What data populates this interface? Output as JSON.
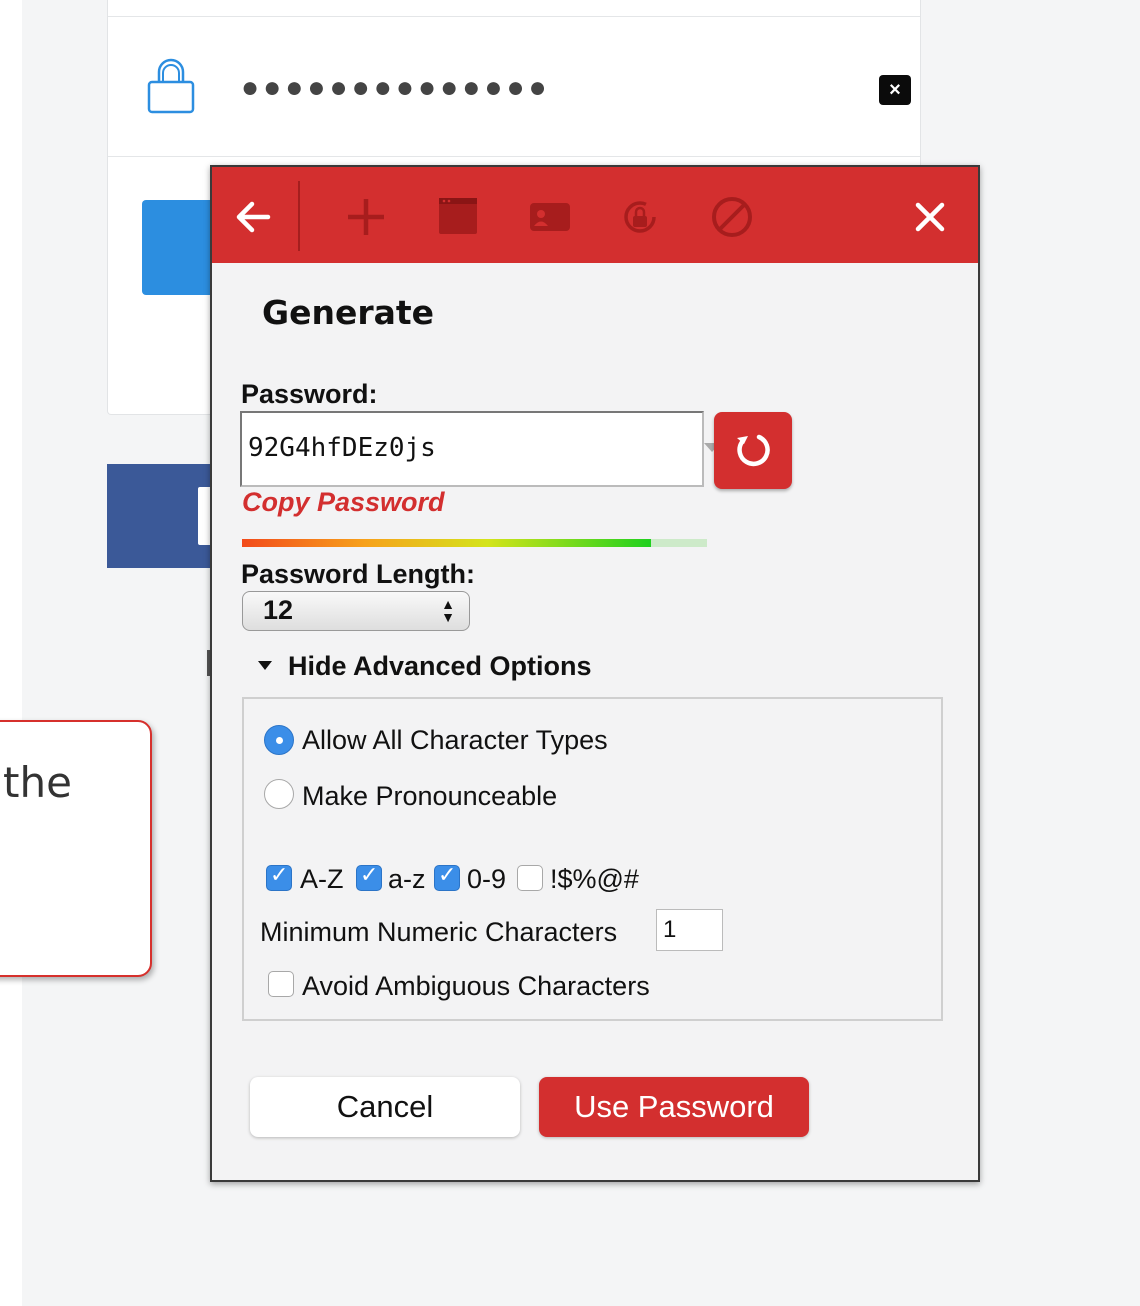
{
  "background": {
    "password_dots": "●●●●●●●●●●●●●●",
    "clear_glyph": "×",
    "tooltip_text": "the"
  },
  "popup": {
    "header_color": "#d32f2f",
    "icons": [
      "back-arrow-icon",
      "plus-icon",
      "site-icon",
      "identity-card-icon",
      "secure-note-icon",
      "never-icon",
      "close-icon"
    ],
    "title": "Generate",
    "password_label": "Password:",
    "password_value": "92G4hfDEz0js",
    "copy_label": "Copy Password",
    "strength_fraction": 0.88,
    "length_label": "Password Length:",
    "length_value": "12",
    "advanced_toggle": "Hide Advanced Options",
    "options": {
      "allow_all": "Allow All Character Types",
      "pronounceable": "Make Pronounceable",
      "selected": "allow_all",
      "charsets": [
        {
          "label": "A-Z",
          "checked": true
        },
        {
          "label": "a-z",
          "checked": true
        },
        {
          "label": "0-9",
          "checked": true
        },
        {
          "label": "!$%@#",
          "checked": false
        }
      ],
      "min_numeric_label": "Minimum Numeric Characters",
      "min_numeric_value": "1",
      "avoid_ambiguous": "Avoid Ambiguous Characters",
      "avoid_ambiguous_checked": false
    },
    "cancel_label": "Cancel",
    "use_label": "Use Password"
  }
}
